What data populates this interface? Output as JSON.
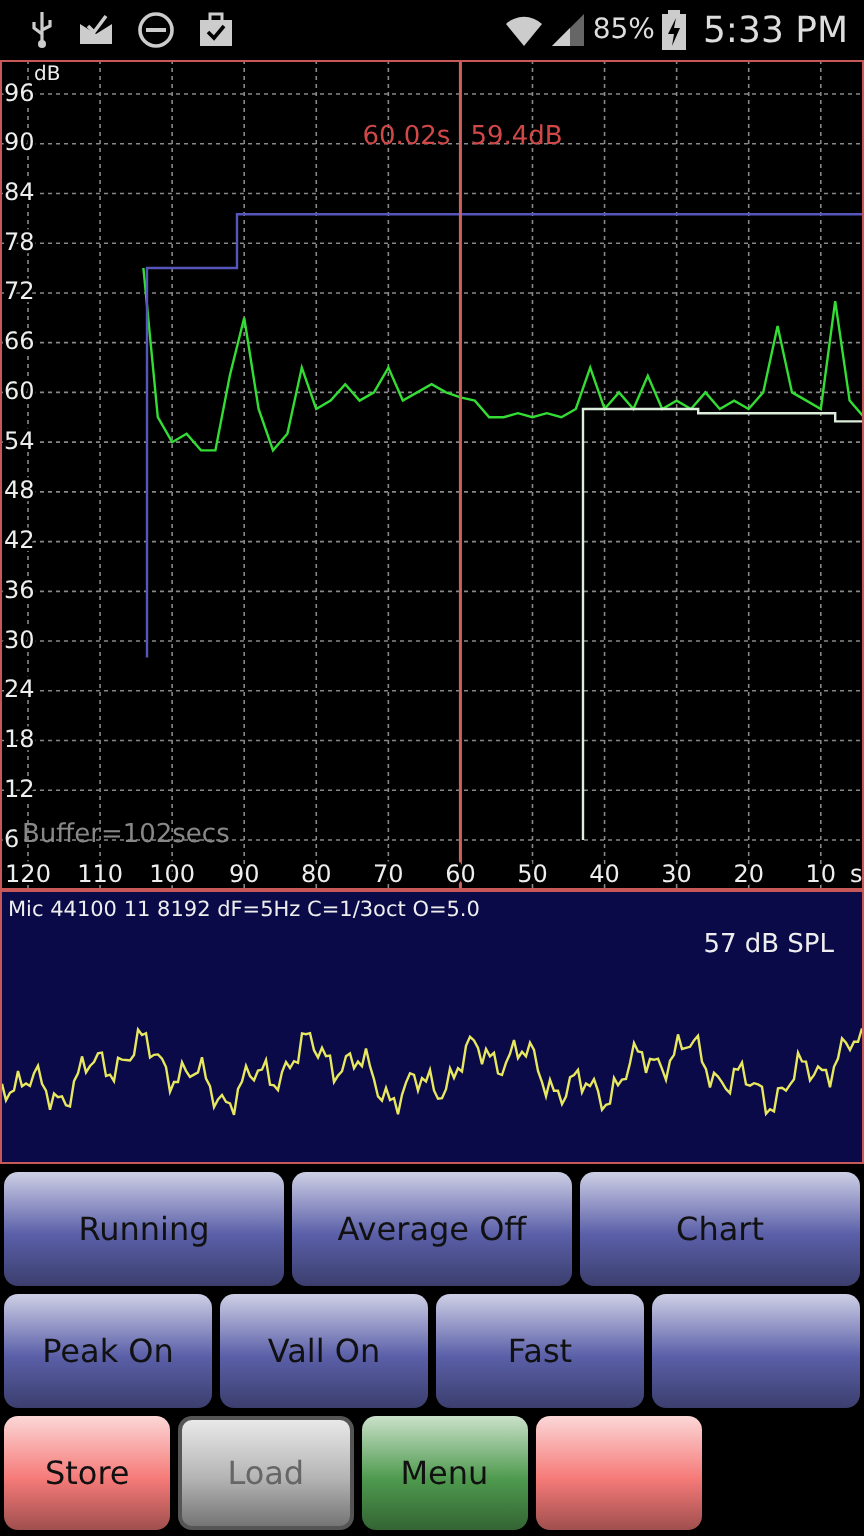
{
  "status_bar": {
    "battery": "85%",
    "time": "5:33 PM"
  },
  "level_chart": {
    "buffer": "Buffer=102secs",
    "chart_data": {
      "type": "line",
      "grid": true,
      "xlabel": "s",
      "ylabel": "dB",
      "xlim": [
        120,
        4
      ],
      "ylim": [
        6,
        96
      ],
      "xticks": [
        120,
        110,
        100,
        90,
        80,
        70,
        60,
        50,
        40,
        30,
        20,
        10
      ],
      "yticks": [
        96,
        90,
        84,
        78,
        72,
        66,
        60,
        54,
        48,
        42,
        36,
        30,
        24,
        18,
        12,
        6
      ],
      "x": [
        104,
        102,
        100,
        98,
        96,
        94,
        92,
        90,
        88,
        86,
        84,
        82,
        80,
        78,
        76,
        74,
        72,
        70,
        68,
        66,
        64,
        62,
        60,
        58,
        56,
        54,
        52,
        50,
        48,
        46,
        44,
        42,
        40,
        38,
        36,
        34,
        32,
        30,
        28,
        26,
        24,
        22,
        20,
        18,
        16,
        14,
        12,
        10,
        8,
        6,
        4
      ],
      "series": [
        {
          "color": "#33dd33",
          "values": [
            75,
            57,
            54,
            55,
            53,
            53,
            62,
            69,
            58,
            53,
            55,
            63,
            58,
            59,
            61,
            59,
            60,
            63,
            59,
            60,
            61,
            60,
            59.4,
            59,
            57,
            57,
            57.5,
            57,
            57.5,
            57,
            58,
            63,
            58,
            60,
            58,
            62,
            58,
            59,
            58,
            60,
            58,
            59,
            58,
            60,
            68,
            60,
            59,
            58,
            71,
            59,
            57
          ]
        },
        {
          "color": "#5555bb",
          "x": [
            103.5,
            103.5,
            91,
            91,
            4
          ],
          "values": [
            28,
            75,
            75,
            81.5,
            81.5
          ]
        },
        {
          "color": "#ddeedd",
          "x": [
            43,
            43,
            27,
            27,
            8,
            8,
            4
          ],
          "values": [
            6,
            58,
            58,
            57.5,
            57.5,
            56.5,
            56.5
          ]
        }
      ],
      "ref_lines": [
        {
          "axis": "x",
          "value": 60,
          "color": "#d06060"
        }
      ],
      "annotations": [
        "60.02s",
        "59.4dB"
      ]
    }
  },
  "spectrum": {
    "info": "Mic 44100 11 8192 dF=5Hz C=1/3oct O=5.0",
    "reading": "57 dB SPL"
  },
  "button_rows": [
    [
      {
        "label": "Running",
        "color": "#5a5fa8",
        "disabled": false
      },
      {
        "label": "Average Off",
        "color": "#5a5fa8",
        "disabled": false
      },
      {
        "label": "Chart",
        "color": "#5a5fa8",
        "disabled": false
      }
    ],
    [
      {
        "label": "Peak On",
        "color": "#5a5fa8",
        "disabled": false
      },
      {
        "label": "Vall On",
        "color": "#5a5fa8",
        "disabled": false
      },
      {
        "label": "Fast",
        "color": "#5a5fa8",
        "disabled": false
      },
      {
        "color": "#5a5fa8",
        "disabled": false
      }
    ],
    [
      {
        "label": "Store",
        "color": "#f57a78",
        "disabled": false
      },
      {
        "label": "Load",
        "color": "#b4b4b4",
        "disabled": true
      },
      {
        "label": "Menu",
        "color": "#4f9a4f",
        "disabled": false
      },
      {
        "color": "#f57a78",
        "disabled": false
      }
    ]
  ]
}
